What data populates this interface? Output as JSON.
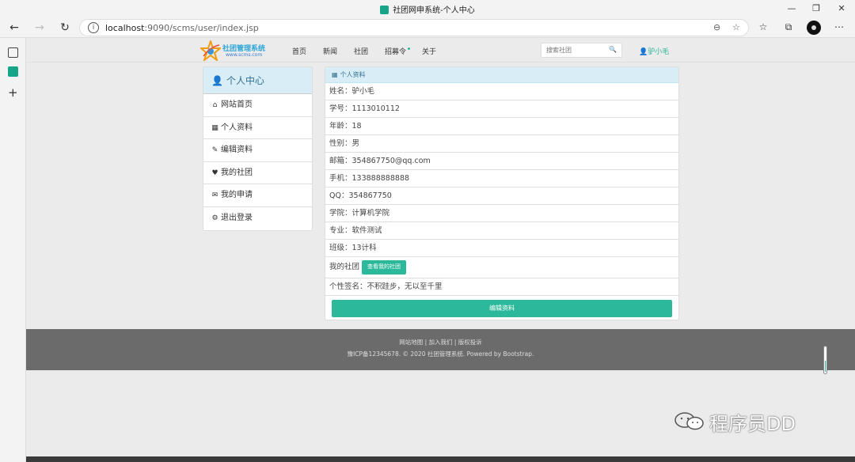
{
  "window": {
    "title": "社团网申系统-个人中心",
    "url_host": "localhost",
    "url_path": ":9090/scms/user/index.jsp"
  },
  "site": {
    "logo_text": "社团管理系统",
    "logo_sub": "www.scms.com",
    "nav": [
      "首页",
      "新闻",
      "社团",
      "招募令",
      "关于"
    ],
    "search_placeholder": "搜索社团",
    "user": "驴小毛"
  },
  "sidebar": {
    "title": "个人中心",
    "items": [
      {
        "label": "网站首页",
        "icon": "home-icon"
      },
      {
        "label": "个人资料",
        "icon": "windows-icon"
      },
      {
        "label": "编辑资料",
        "icon": "edit-icon"
      },
      {
        "label": "我的社团",
        "icon": "heart-icon"
      },
      {
        "label": "我的申请",
        "icon": "envelope-icon"
      },
      {
        "label": "退出登录",
        "icon": "gear-icon"
      }
    ]
  },
  "profile": {
    "title": "个人资料",
    "rows": [
      "姓名：驴小毛",
      "学号：1113010112",
      "年龄：18",
      "性别：男",
      "邮箱：354867750@qq.com",
      "手机：133888888888",
      "QQ：354867750",
      "学院：计算机学院",
      "专业：软件测试",
      "班级：13计科"
    ],
    "club_label": "我的社团",
    "club_button": "查看我的社团",
    "signature": "个性签名：不积跬步，无以至千里",
    "edit_button": "编辑资料"
  },
  "footer": {
    "links": "网站地图 | 加入我们 | 版权投诉",
    "copyright": "豫ICP备12345678. © 2020 社团管理系统. Powered by Bootstrap."
  },
  "watermark": "程序员DD",
  "colors": {
    "accent": "#2cb89a",
    "panel_header": "#d9edf7",
    "footer_bg": "#6b6b6b"
  }
}
